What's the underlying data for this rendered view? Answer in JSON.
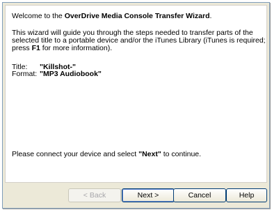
{
  "wizard": {
    "welcome_prefix": "Welcome to the ",
    "welcome_bold": "OverDrive Media Console Transfer Wizard",
    "welcome_suffix": ".",
    "intro_part1": "This wizard will guide you through the steps needed to transfer parts of the selected title to a portable device and/or the iTunes Library (iTunes is required; press ",
    "intro_key": "F1",
    "intro_part2": " for more information).",
    "title_label": "Title:",
    "title_value": "\"Killshot-\"",
    "format_label": "Format:",
    "format_value": "\"MP3 Audiobook\"",
    "prompt_prefix": "Please connect your device and select ",
    "prompt_bold": "\"Next\"",
    "prompt_suffix": " to continue."
  },
  "buttons": {
    "back": "< Back",
    "next": "Next >",
    "cancel": "Cancel",
    "help": "Help"
  }
}
